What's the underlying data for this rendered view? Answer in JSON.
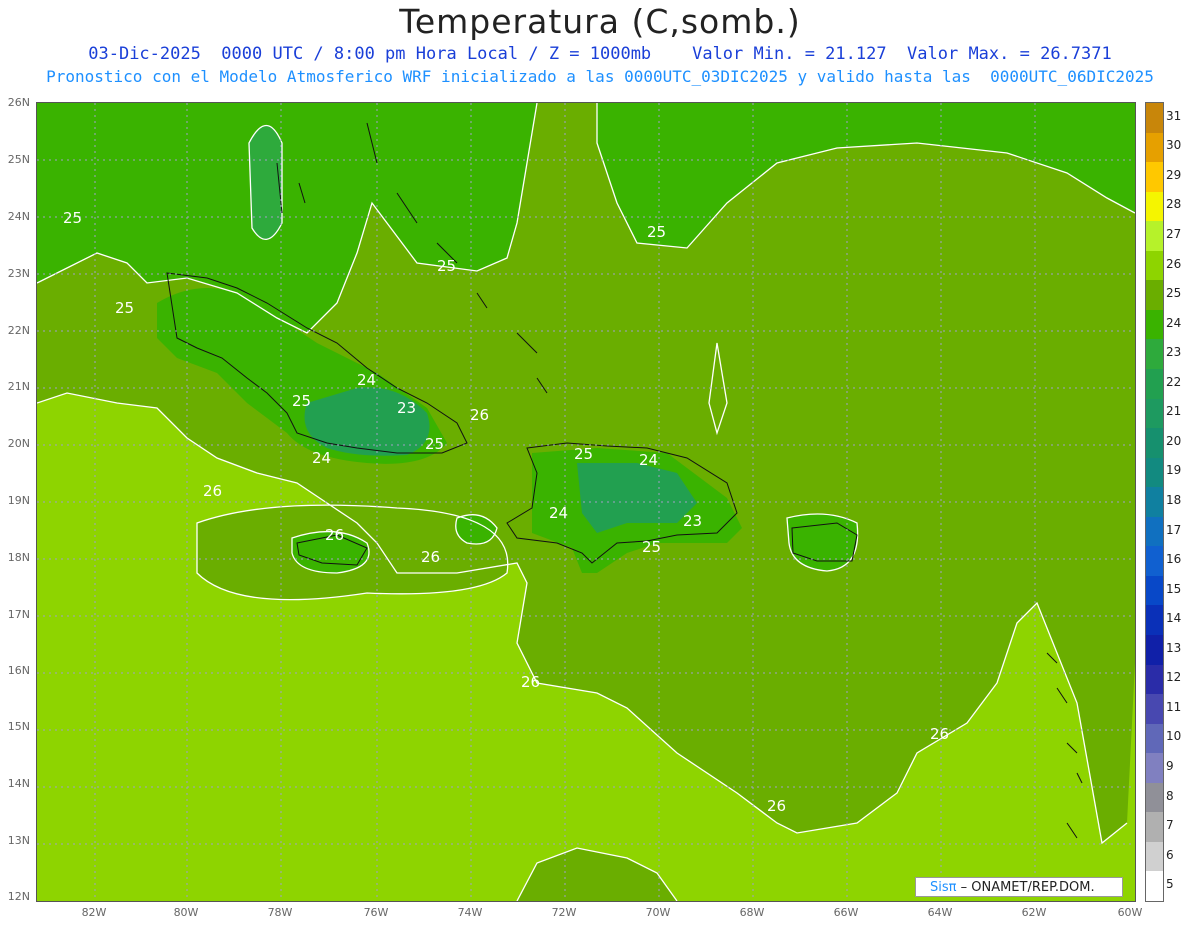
{
  "title": "Temperatura (C,somb.)",
  "subtitle_line1": "03-Dic-2025  0000 UTC / 8:00 pm Hora Local / Z = 1000mb    Valor Min. = 21.127  Valor Max. = 26.7371",
  "subtitle_line2": "Pronostico con el Modelo Atmosferico WRF inicializado a las 0000UTC_03DIC2025 y valido hasta las  0000UTC_06DIC2025",
  "lat_labels": [
    "26N",
    "25N",
    "24N",
    "23N",
    "22N",
    "21N",
    "20N",
    "19N",
    "18N",
    "17N",
    "16N",
    "15N",
    "14N",
    "13N",
    "12N"
  ],
  "lon_labels": [
    "82W",
    "80W",
    "78W",
    "76W",
    "74W",
    "72W",
    "70W",
    "68W",
    "66W",
    "64W",
    "62W",
    "60W"
  ],
  "contour_labels": [
    "25",
    "25",
    "25",
    "25",
    "24",
    "25",
    "23",
    "24",
    "25",
    "26",
    "26",
    "26",
    "26",
    "25",
    "24",
    "24",
    "23",
    "25",
    "26",
    "26",
    "26"
  ],
  "colorbar": {
    "labels": [
      "31",
      "30",
      "29",
      "28",
      "27",
      "26",
      "25",
      "24",
      "23",
      "22",
      "21",
      "20",
      "19",
      "18",
      "17",
      "16",
      "15",
      "14",
      "13",
      "12",
      "11",
      "10",
      "9",
      "8",
      "7",
      "6",
      "5"
    ],
    "colors": [
      "#c8860a",
      "#e6a000",
      "#ffc800",
      "#f5f500",
      "#b6f22a",
      "#8ed400",
      "#6aae00",
      "#3ab300",
      "#2eaa3c",
      "#22a050",
      "#1e9a60",
      "#16906e",
      "#128a80",
      "#1080a0",
      "#1070c0",
      "#1060d0",
      "#0848c8",
      "#0a30b8",
      "#1020a8",
      "#2a2ca8",
      "#4848b0",
      "#6068b8",
      "#8080c0",
      "#909098",
      "#b0b0b0",
      "#d0d0d0",
      "#ffffff"
    ]
  },
  "credit_brand": "Sisπ",
  "credit_text": " – ONAMET/REP.DOM."
}
